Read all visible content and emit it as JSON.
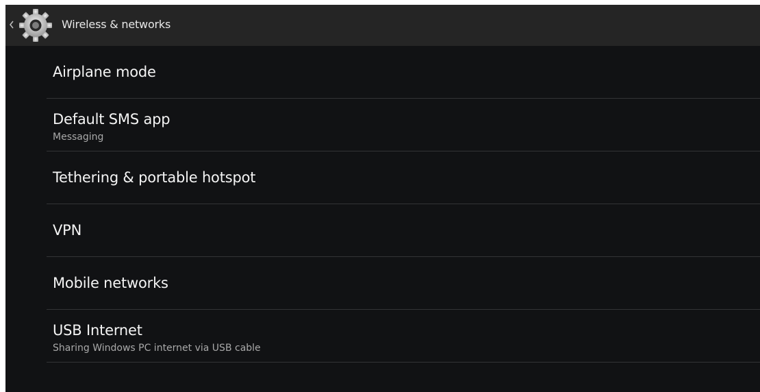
{
  "header": {
    "title": "Wireless & networks",
    "icon": "settings-gear-icon",
    "up_icon": "chevron-left-icon"
  },
  "colors": {
    "background": "#111214",
    "action_bar": "#252525",
    "divider": "#333436",
    "title_text": "#f4f4f4",
    "summary_text": "#a9a9a9"
  },
  "items": [
    {
      "title": "Airplane mode",
      "summary": ""
    },
    {
      "title": "Default SMS app",
      "summary": "Messaging"
    },
    {
      "title": "Tethering & portable hotspot",
      "summary": ""
    },
    {
      "title": "VPN",
      "summary": ""
    },
    {
      "title": "Mobile networks",
      "summary": ""
    },
    {
      "title": "USB Internet",
      "summary": "Sharing Windows PC internet via USB cable"
    }
  ]
}
